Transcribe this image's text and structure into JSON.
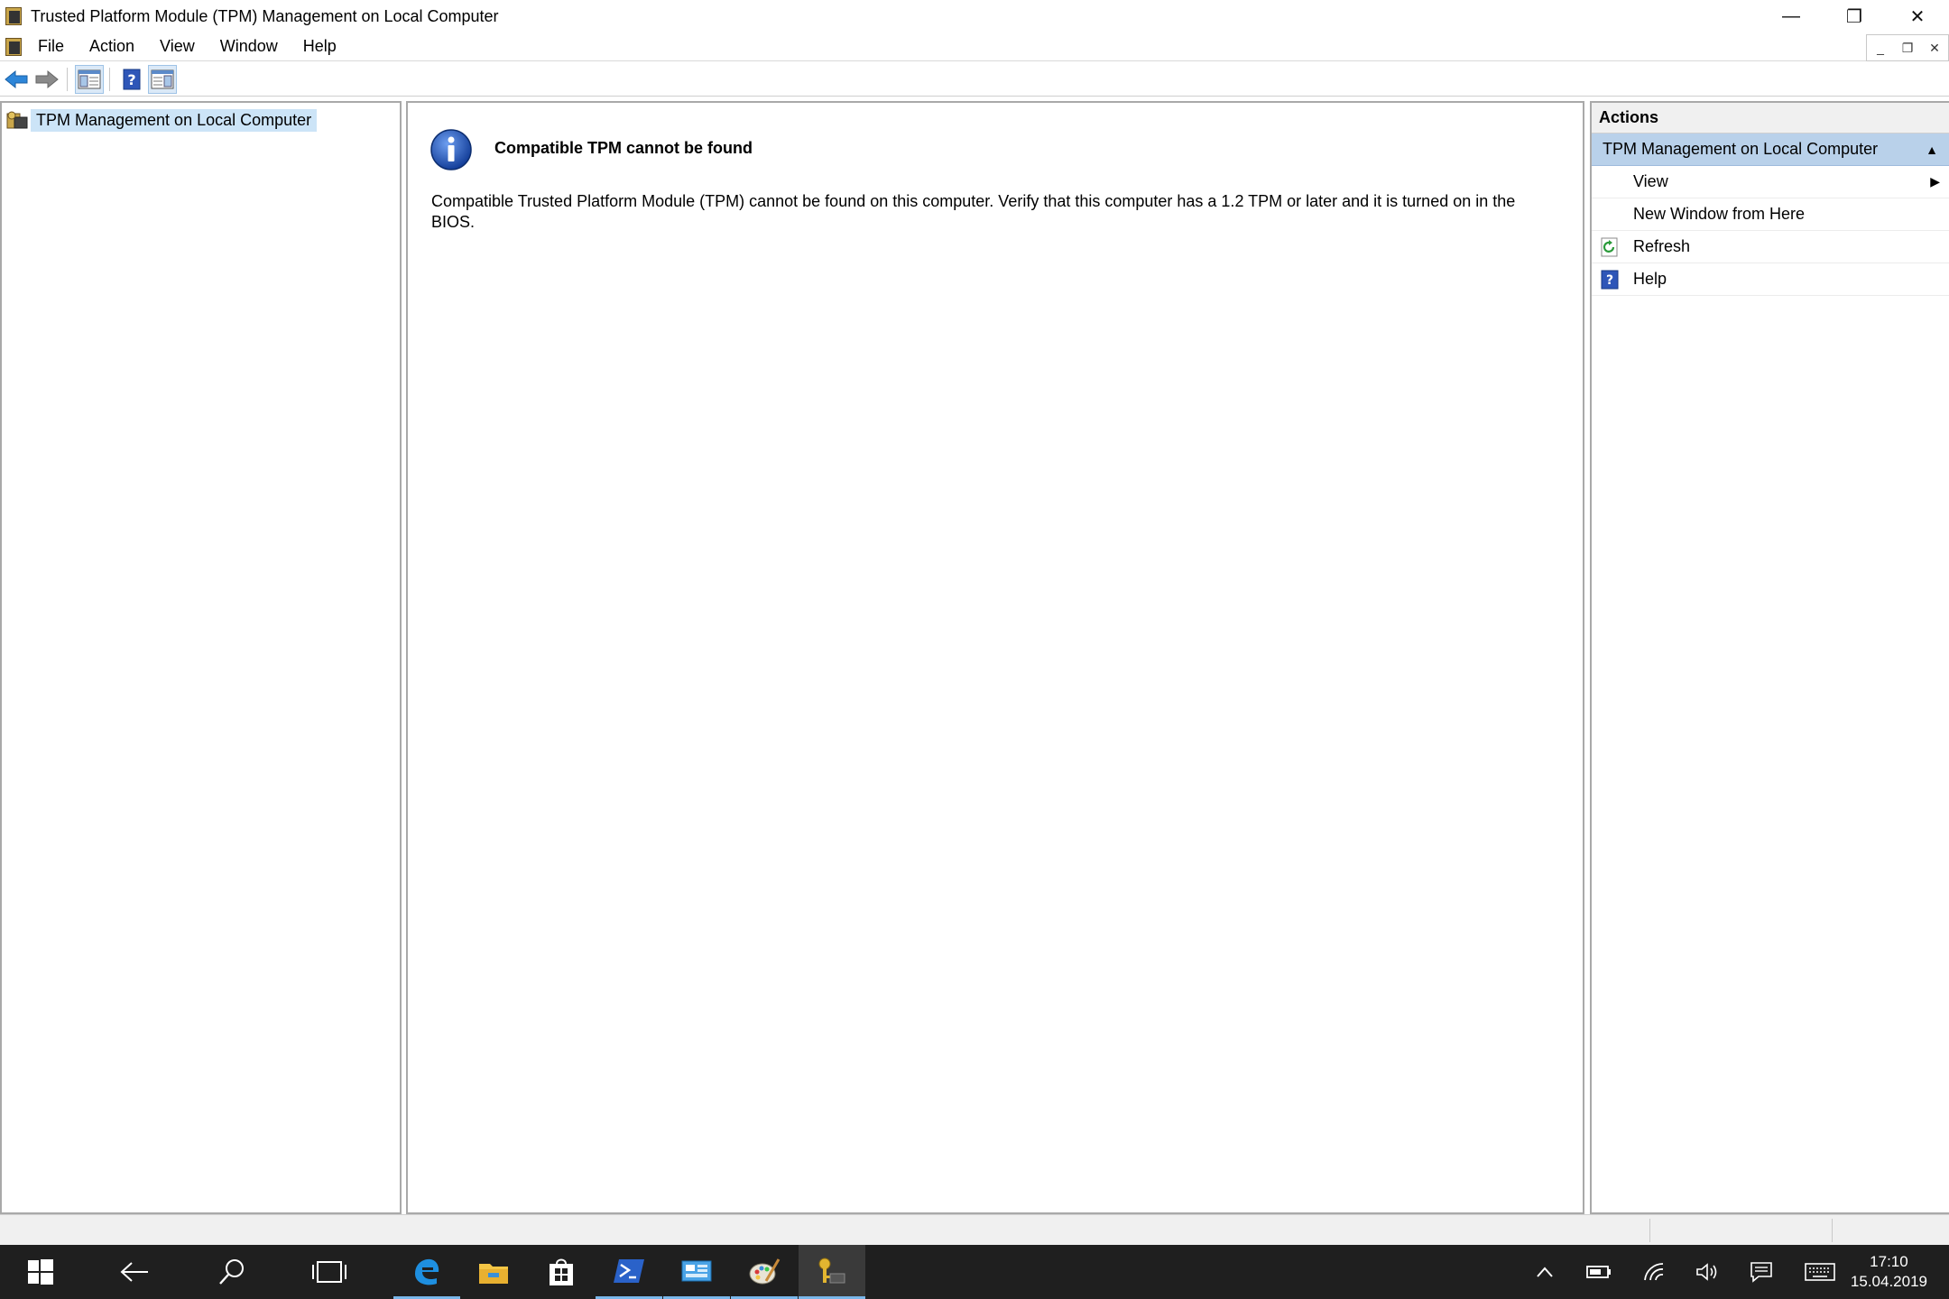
{
  "window": {
    "title": "Trusted Platform Module (TPM) Management on Local Computer",
    "minimize_glyph": "—",
    "restore_glyph": "❐",
    "close_glyph": "✕"
  },
  "menu": {
    "items": [
      "File",
      "Action",
      "View",
      "Window",
      "Help"
    ]
  },
  "mdi_controls": {
    "minimize": "_",
    "restore": "❐",
    "close": "✕"
  },
  "toolbar": {
    "back_icon": "back-arrow-icon",
    "forward_icon": "forward-arrow-icon",
    "show_hide_tree_icon": "console-tree-icon",
    "help_icon": "help-icon",
    "show_hide_action_pane_icon": "action-pane-icon"
  },
  "tree": {
    "root_label": "TPM Management on Local Computer"
  },
  "content": {
    "heading": "Compatible TPM cannot be found",
    "message": "Compatible Trusted Platform Module (TPM) cannot be found on this computer. Verify that this computer has a 1.2 TPM or later and it is turned on in the BIOS."
  },
  "actions": {
    "header": "Actions",
    "group_label": "TPM Management on Local Computer",
    "items": [
      {
        "label": "View",
        "has_submenu": true
      },
      {
        "label": "New Window from Here",
        "has_submenu": false
      },
      {
        "label": "Refresh",
        "icon": "refresh-icon"
      },
      {
        "label": "Help",
        "icon": "help-icon"
      }
    ]
  },
  "taskbar": {
    "clock_time": "17:10",
    "clock_date": "15.04.2019"
  },
  "colors": {
    "selection": "#cce4f7",
    "actions_group": "#b9d1ea",
    "taskbar": "#1f1f1f",
    "taskbar_accent": "#7ab7ea",
    "info_blue": "#1a4fb0"
  }
}
